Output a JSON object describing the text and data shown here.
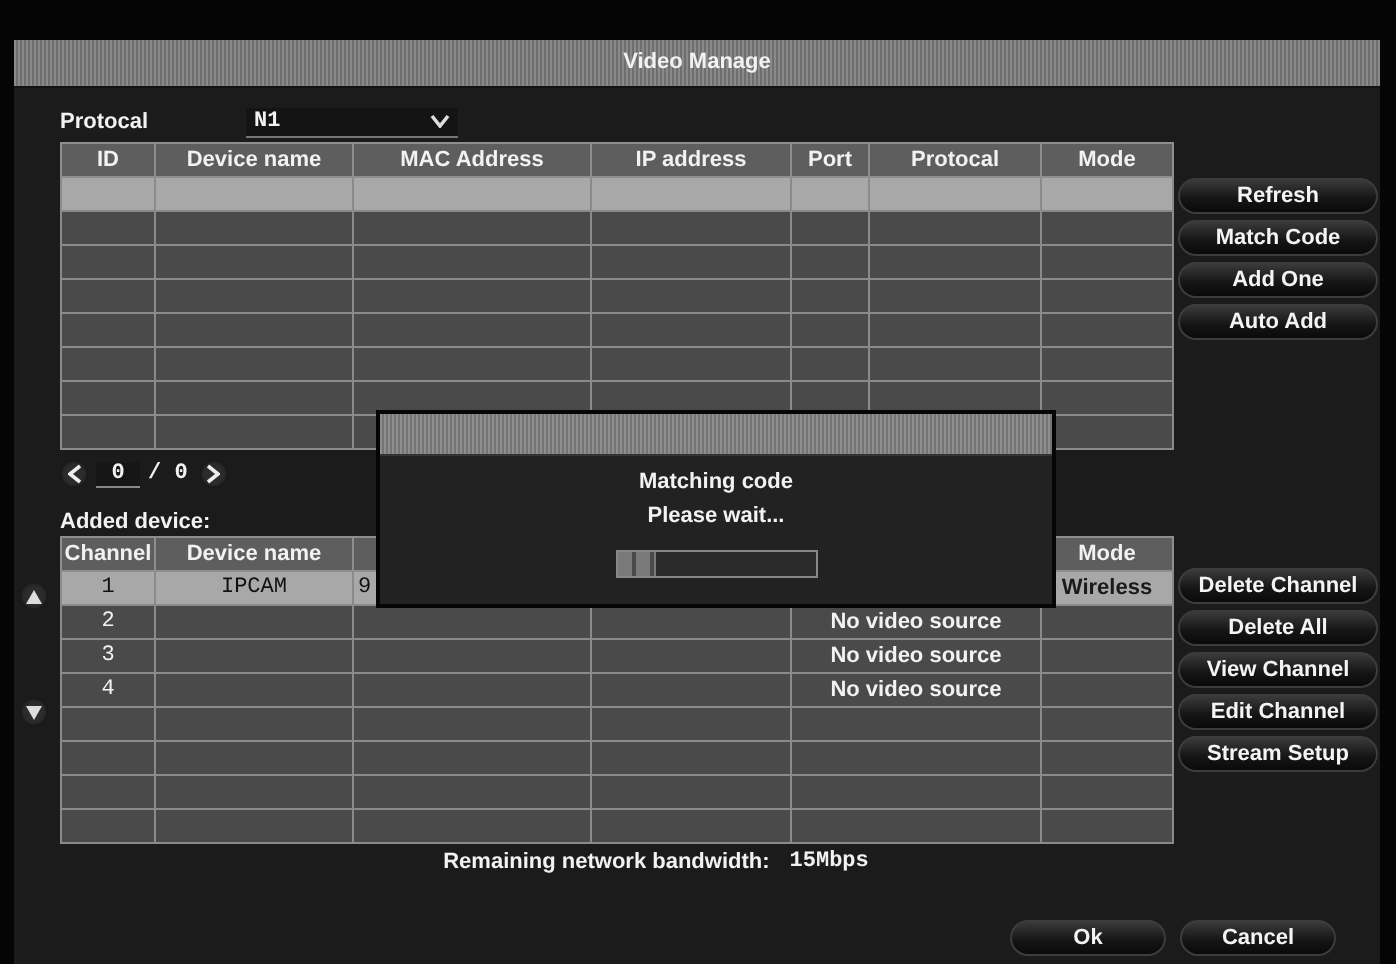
{
  "window": {
    "title": "Video Manage"
  },
  "protocol": {
    "label": "Protocal",
    "value": "N1"
  },
  "search_table": {
    "columns": [
      "ID",
      "Device name",
      "MAC Address",
      "IP address",
      "Port",
      "Protocal",
      "Mode"
    ],
    "rows": [
      {
        "selected": true
      },
      {
        "selected": false
      },
      {
        "selected": false
      },
      {
        "selected": false
      },
      {
        "selected": false
      },
      {
        "selected": false
      },
      {
        "selected": false
      },
      {
        "selected": false
      }
    ]
  },
  "pager": {
    "page": "0",
    "total": "/ 0"
  },
  "search_buttons": [
    "Refresh",
    "Match Code",
    "Add One",
    "Auto Add"
  ],
  "added_device": {
    "label": "Added device:",
    "columns": [
      "Channel",
      "Device name",
      null,
      null,
      null,
      "Mode"
    ],
    "rows": [
      {
        "selected": true,
        "cells": [
          "1",
          "IPCAM",
          "9",
          null,
          null,
          "Wireless"
        ]
      },
      {
        "selected": false,
        "cells": [
          "2",
          null,
          null,
          null,
          "No video source",
          null
        ]
      },
      {
        "selected": false,
        "cells": [
          "3",
          null,
          null,
          null,
          "No video source",
          null
        ]
      },
      {
        "selected": false,
        "cells": [
          "4",
          null,
          null,
          null,
          "No video source",
          null
        ]
      },
      {
        "selected": false
      },
      {
        "selected": false
      },
      {
        "selected": false
      },
      {
        "selected": false
      }
    ]
  },
  "channel_buttons": [
    "Delete Channel",
    "Delete All",
    "View Channel",
    "Edit Channel",
    "Stream Setup"
  ],
  "bandwidth": {
    "label": "Remaining network bandwidth:",
    "value": "15Mbps"
  },
  "footer_buttons": [
    "Ok",
    "Cancel"
  ],
  "dialog": {
    "message": "Matching code",
    "status": "Please wait...",
    "progress": {
      "level": 0.2
    }
  }
}
